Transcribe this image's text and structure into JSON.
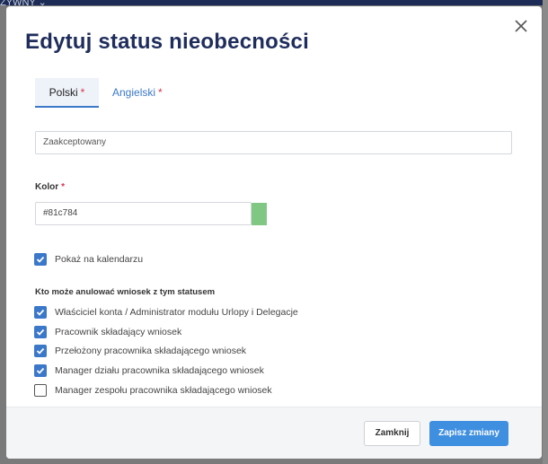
{
  "backdrop": {
    "label": "ŻYWNY ⌄"
  },
  "modal": {
    "title": "Edytuj status nieobecności",
    "close_icon": "close-icon"
  },
  "tabs": [
    {
      "label": "Polski",
      "required": "*",
      "active": true
    },
    {
      "label": "Angielski",
      "required": "*",
      "active": false
    }
  ],
  "name_input": {
    "value": "Zaakceptowany"
  },
  "color_field": {
    "label": "Kolor",
    "required": "*",
    "value": "#81c784",
    "swatch_color": "#81c784"
  },
  "show_on_calendar": {
    "label": "Pokaż na kalendarzu",
    "checked": true
  },
  "cancel_permissions": {
    "heading": "Kto może anulować wniosek z tym statusem",
    "options": [
      {
        "label": "Właściciel konta / Administrator modułu Urlopy i Delegacje",
        "checked": true
      },
      {
        "label": "Pracownik składający wniosek",
        "checked": true
      },
      {
        "label": "Przełożony pracownika składającego wniosek",
        "checked": true
      },
      {
        "label": "Manager działu pracownika składającego wniosek",
        "checked": true
      },
      {
        "label": "Manager zespołu pracownika składającego wniosek",
        "checked": false
      }
    ]
  },
  "footer": {
    "close_label": "Zamknij",
    "save_label": "Zapisz zmiany"
  },
  "colors": {
    "accent": "#3b78c9",
    "primary_button": "#3f8fe0",
    "title": "#1f2d5c",
    "required": "#d9324a"
  }
}
